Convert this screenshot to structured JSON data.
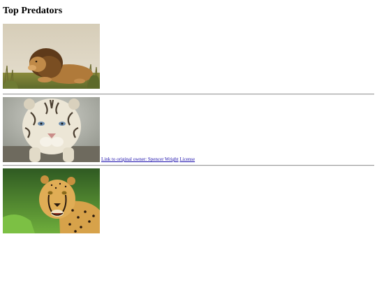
{
  "page": {
    "title": "Top Predators"
  },
  "photos": [
    {
      "subject": "lion",
      "icon": "lion-photo"
    },
    {
      "subject": "white tiger",
      "icon": "white-tiger-photo"
    },
    {
      "subject": "cheetah",
      "icon": "cheetah-photo"
    }
  ],
  "credits": {
    "owner_link": "Link to original owner: Spencer Wright",
    "license_link": "License"
  }
}
